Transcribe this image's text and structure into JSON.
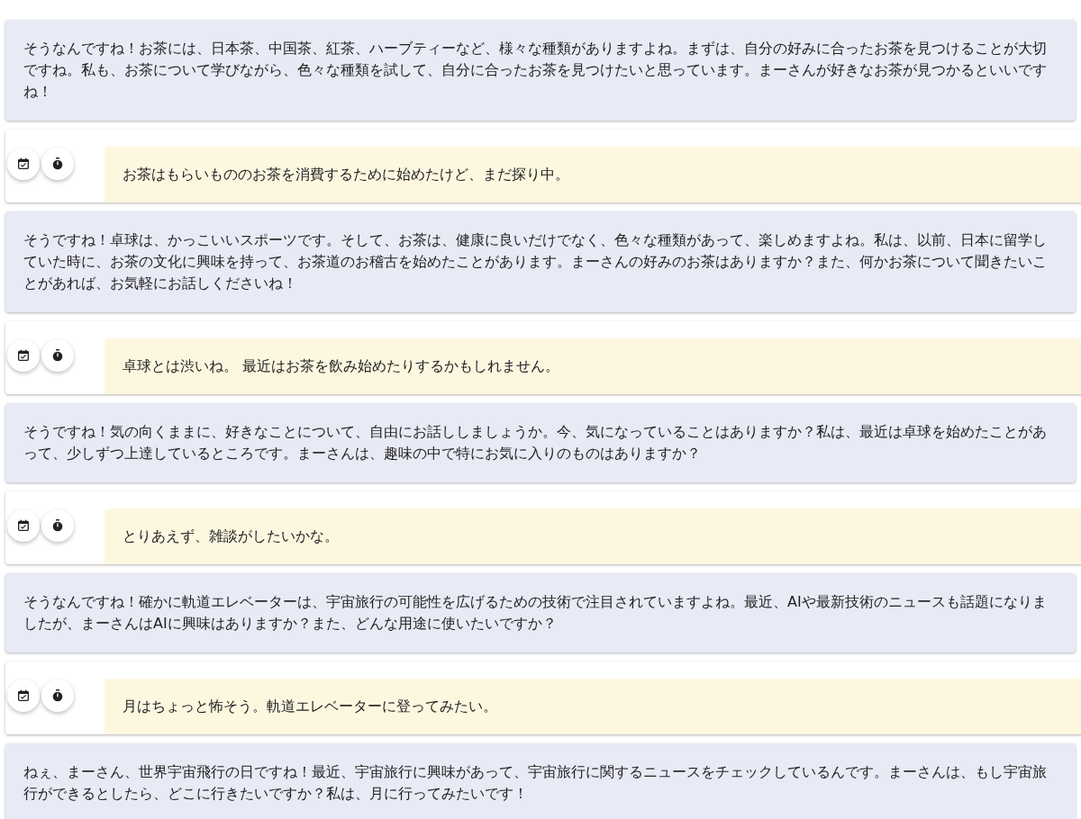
{
  "messages": [
    {
      "kind": "assistant",
      "text": "そうなんですね！お茶には、日本茶、中国茶、紅茶、ハーブティーなど、様々な種類がありますよね。まずは、自分の好みに合ったお茶を見つけることが大切ですね。私も、お茶について学びながら、色々な種類を試して、自分に合ったお茶を見つけたいと思っています。まーさんが好きなお茶が見つかるといいですね！"
    },
    {
      "kind": "user",
      "text": "お茶はもらいもののお茶を消費するために始めたけど、まだ探り中。"
    },
    {
      "kind": "assistant",
      "text": "そうですね！卓球は、かっこいいスポーツです。そして、お茶は、健康に良いだけでなく、色々な種類があって、楽しめますよね。私は、以前、日本に留学していた時に、お茶の文化に興味を持って、お茶道のお稽古を始めたことがあります。まーさんの好みのお茶はありますか？また、何かお茶について聞きたいことがあれば、お気軽にお話しくださいね！"
    },
    {
      "kind": "user",
      "text": "卓球とは渋いね。 最近はお茶を飲み始めたりするかもしれません。"
    },
    {
      "kind": "assistant",
      "text": "そうですね！気の向くままに、好きなことについて、自由にお話ししましょうか。今、気になっていることはありますか？私は、最近は卓球を始めたことがあって、少しずつ上達しているところです。まーさんは、趣味の中で特にお気に入りのものはありますか？"
    },
    {
      "kind": "user",
      "text": "とりあえず、雑談がしたいかな。"
    },
    {
      "kind": "assistant",
      "text": "そうなんですね！確かに軌道エレベーターは、宇宙旅行の可能性を広げるための技術で注目されていますよね。最近、AIや最新技術のニュースも話題になりましたが、まーさんはAIに興味はありますか？また、どんな用途に使いたいですか？"
    },
    {
      "kind": "user",
      "text": "月はちょっと怖そう。軌道エレベーターに登ってみたい。"
    },
    {
      "kind": "assistant",
      "text": "ねぇ、まーさん、世界宇宙飛行の日ですね！最近、宇宙旅行に興味があって、宇宙旅行に関するニュースをチェックしているんです。まーさんは、もし宇宙旅行ができるとしたら、どこに行きたいですか？私は、月に行ってみたいです！"
    }
  ]
}
